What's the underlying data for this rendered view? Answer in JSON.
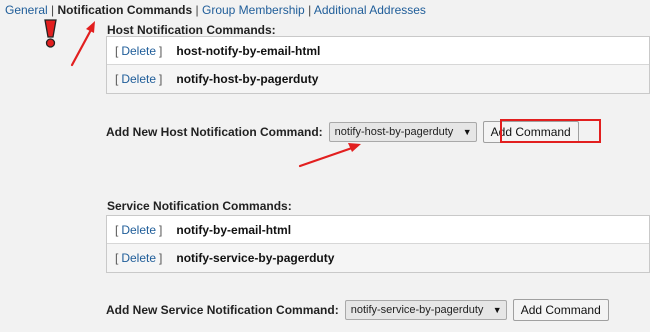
{
  "tabs": {
    "general": "General",
    "notification_commands": "Notification Commands",
    "group_membership": "Group Membership",
    "additional_addresses": "Additional Addresses",
    "separator": "|"
  },
  "host": {
    "title": "Host Notification Commands:",
    "commands": [
      {
        "delete_label": "Delete",
        "name": "host-notify-by-email-html"
      },
      {
        "delete_label": "Delete",
        "name": "notify-host-by-pagerduty"
      }
    ],
    "add_label": "Add New Host Notification Command:",
    "add_selected": "notify-host-by-pagerduty",
    "add_button": "Add Command"
  },
  "service": {
    "title": "Service Notification Commands:",
    "commands": [
      {
        "delete_label": "Delete",
        "name": "notify-by-email-html"
      },
      {
        "delete_label": "Delete",
        "name": "notify-service-by-pagerduty"
      }
    ],
    "add_label": "Add New Service Notification Command:",
    "add_selected": "notify-service-by-pagerduty",
    "add_button": "Add Command"
  },
  "brackets": {
    "open": "[",
    "close": "]"
  },
  "colors": {
    "link": "#1f5d99",
    "annotation_red": "#e21f1f",
    "background": "#f2f2f2"
  },
  "icons": {
    "warning": "exclamation-icon",
    "select_arrow": "dropdown-arrow-icon"
  }
}
